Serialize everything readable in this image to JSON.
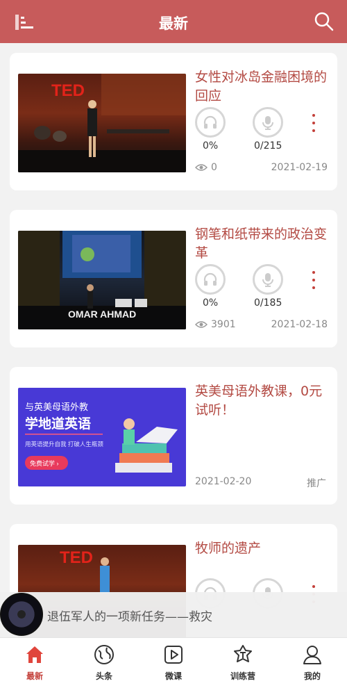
{
  "header": {
    "title": "最新"
  },
  "cards": [
    {
      "title": "女性对冰岛金融困境的回应",
      "progress": "0%",
      "listen": "0/215",
      "views": "0",
      "date": "2021-02-19",
      "thumb_text": "TED"
    },
    {
      "title": "钢笔和纸带来的政治变革",
      "progress": "0%",
      "listen": "0/185",
      "views": "3901",
      "date": "2021-02-18",
      "thumb_text": "OMAR AHMAD"
    },
    {
      "title": "英美母语外教课，0元试听！",
      "date": "2021-02-20",
      "ad_label": "推广",
      "ad": {
        "line1": "与英美母语外教",
        "line2": "学地道英语",
        "line3": "用英语提升自我 打破人生瓶颈",
        "cta": "免费试学 ›"
      }
    },
    {
      "title": "牧师的遗产",
      "thumb_text": "TED"
    }
  ],
  "player": {
    "title": "退伍军人的一项新任务——救灾"
  },
  "tabs": [
    {
      "label": "最新",
      "icon": "home-icon"
    },
    {
      "label": "头条",
      "icon": "globe-icon"
    },
    {
      "label": "微课",
      "icon": "play-icon"
    },
    {
      "label": "训练营",
      "icon": "badge-icon"
    },
    {
      "label": "我的",
      "icon": "user-icon"
    }
  ],
  "colors": {
    "header": "#c75b5b",
    "accent": "#c3403a",
    "title": "#b34a43"
  }
}
